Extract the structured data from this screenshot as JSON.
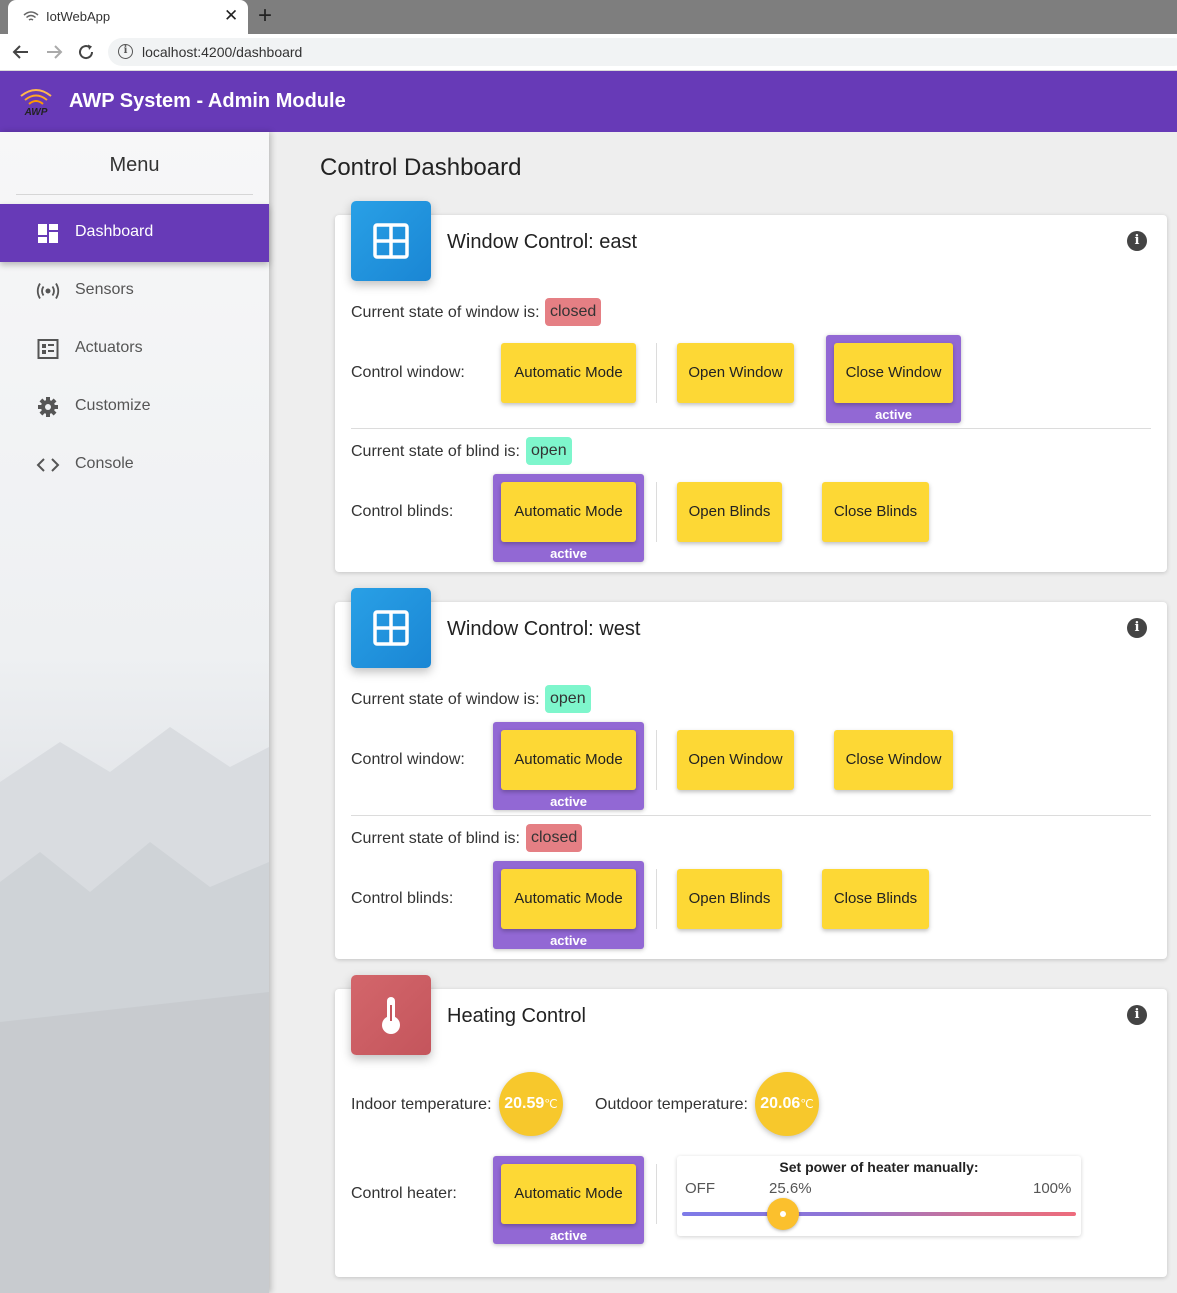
{
  "browser": {
    "tab_title": "IotWebApp",
    "tab_close": "✕",
    "new_tab": "+",
    "url": "localhost:4200/dashboard",
    "info": "i"
  },
  "app": {
    "title": "AWP System - Admin Module",
    "logo_text": "AWP",
    "accent": "#673ab7"
  },
  "sidebar": {
    "menu_title": "Menu",
    "items": [
      {
        "label": "Dashboard",
        "icon": "dashboard-icon",
        "active": true
      },
      {
        "label": "Sensors",
        "icon": "sensors-icon",
        "active": false
      },
      {
        "label": "Actuators",
        "icon": "actuators-icon",
        "active": false
      },
      {
        "label": "Customize",
        "icon": "gear-icon",
        "active": false
      },
      {
        "label": "Console",
        "icon": "code-icon",
        "active": false
      }
    ]
  },
  "main": {
    "page_title": "Control Dashboard",
    "cards": [
      {
        "title": "Window Control: east",
        "icon": "window-icon",
        "window_state_label": "Current state of window is:",
        "window_state": "closed",
        "control_window_label": "Control window:",
        "window_buttons": [
          "Automatic Mode",
          "Open Window",
          "Close Window"
        ],
        "window_active": "Close Window",
        "blind_state_label": "Current state of blind is:",
        "blind_state": "open",
        "control_blinds_label": "Control blinds:",
        "blind_buttons": [
          "Automatic Mode",
          "Open Blinds",
          "Close Blinds"
        ],
        "blind_active": "Automatic Mode",
        "active_label": "active"
      },
      {
        "title": "Window Control: west",
        "icon": "window-icon",
        "window_state_label": "Current state of window is:",
        "window_state": "open",
        "control_window_label": "Control window:",
        "window_buttons": [
          "Automatic Mode",
          "Open Window",
          "Close Window"
        ],
        "window_active": "Automatic Mode",
        "blind_state_label": "Current state of blind is:",
        "blind_state": "closed",
        "control_blinds_label": "Control blinds:",
        "blind_buttons": [
          "Automatic Mode",
          "Open Blinds",
          "Close Blinds"
        ],
        "blind_active": "Automatic Mode",
        "active_label": "active"
      }
    ],
    "heating": {
      "title": "Heating Control",
      "icon": "thermometer-icon",
      "indoor_label": "Indoor temperature:",
      "indoor_value": "20.59",
      "outdoor_label": "Outdoor temperature:",
      "outdoor_value": "20.06",
      "unit": "℃",
      "control_label": "Control heater:",
      "auto_button": "Automatic Mode",
      "active_label": "active",
      "slider_title": "Set power of heater manually:",
      "slider_min": "OFF",
      "slider_value": "25.6%",
      "slider_max": "100%",
      "slider_fraction": 0.256
    },
    "info_icon": "i"
  }
}
